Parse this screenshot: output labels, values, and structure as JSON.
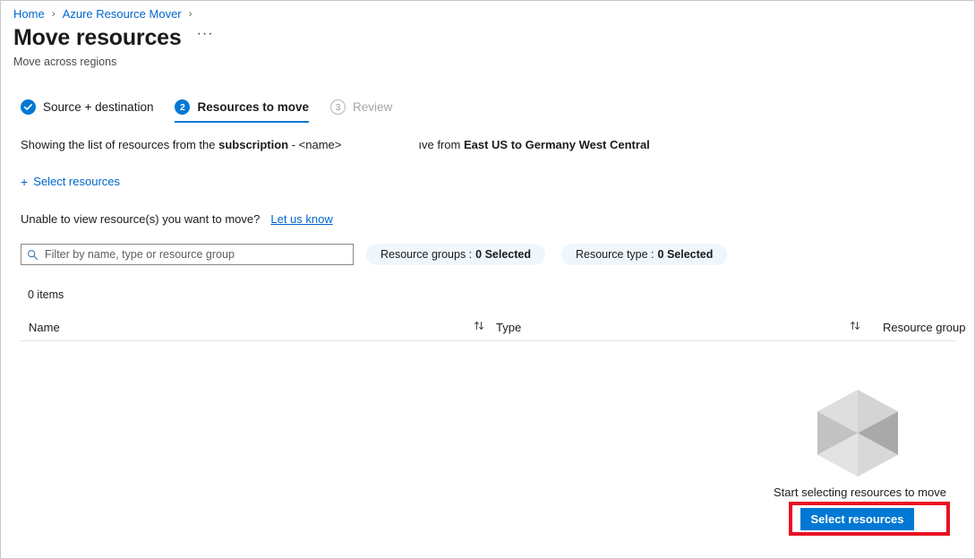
{
  "breadcrumb": {
    "items": [
      {
        "label": "Home"
      },
      {
        "label": "Azure Resource Mover"
      }
    ],
    "separator": "›"
  },
  "header": {
    "title": "Move resources",
    "subtitle": "Move across regions",
    "more_label": "···"
  },
  "wizard": {
    "steps": [
      {
        "badge": "✓",
        "label": "Source + destination",
        "state": "done"
      },
      {
        "badge": "2",
        "label": "Resources to move",
        "state": "current"
      },
      {
        "badge": "3",
        "label": "Review",
        "state": "pending"
      }
    ]
  },
  "description": {
    "prefix": "Showing the list of resources from the ",
    "subscription_bold": "subscription",
    "middle": " - <name>",
    "clipped": "ıve from ",
    "regions_bold": "East US to Germany West Central"
  },
  "actions": {
    "select_resources_link": "Select resources",
    "plus_icon": "+",
    "unable_text": "Unable to view resource(s) you want to move?",
    "let_us_know": "Let us know"
  },
  "filters": {
    "search_placeholder": "Filter by name, type or resource group",
    "search_value": "",
    "pills": [
      {
        "label": "Resource groups :",
        "value": "0 Selected"
      },
      {
        "label": "Resource type :",
        "value": "0 Selected"
      }
    ]
  },
  "table": {
    "items_count": "0 items",
    "columns": [
      {
        "label": "Name"
      },
      {
        "label": "Type"
      },
      {
        "label": "Resource group"
      }
    ],
    "rows": []
  },
  "empty_state": {
    "message": "Start selecting resources to move",
    "button_label": "Select resources"
  },
  "colors": {
    "accent": "#0078d4",
    "link": "#0066cc",
    "highlight": "#e81123",
    "pill_bg": "#eff6fc"
  }
}
